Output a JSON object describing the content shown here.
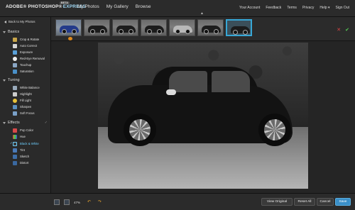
{
  "app": {
    "logo": "ADOBE® PHOTOSHOP®",
    "logo_express": "EXPRESS",
    "beta": "BETA"
  },
  "nav": {
    "main": [
      "My Photos",
      "My Gallery",
      "Browse"
    ],
    "right": [
      "Your Account",
      "Feedback",
      "Terms",
      "Privacy",
      "Help ▾",
      "Sign Out"
    ]
  },
  "sidebar": {
    "back": "Back to My Photos",
    "sections": [
      {
        "title": "Basics",
        "tools": [
          "Crop & Rotate",
          "Auto Correct",
          "Exposure",
          "Red-Eye Removal",
          "Touchup",
          "Saturation"
        ]
      },
      {
        "title": "Tuning",
        "tools": [
          "White Balance",
          "Highlight",
          "Fill Light",
          "Sharpen",
          "Soft Focus"
        ]
      },
      {
        "title": "Effects",
        "tools": [
          "Pop Color",
          "Hue",
          "Black & White",
          "Tint",
          "Sketch",
          "Distort"
        ]
      }
    ],
    "active_tool": "Black & White"
  },
  "filmstrip": {
    "count": 7,
    "selected_index": 6
  },
  "bottom": {
    "zoom": "47%",
    "view_original": "View Original",
    "reset_all": "Reset All",
    "cancel": "Cancel",
    "save": "Save"
  },
  "colors": {
    "accent": "#37a7d6",
    "save": "#3a8fc8",
    "undo": "#e0a030"
  },
  "icons": {
    "undo": "undo-icon",
    "redo": "redo-icon",
    "cancel": "close-icon",
    "accept": "check-icon"
  }
}
